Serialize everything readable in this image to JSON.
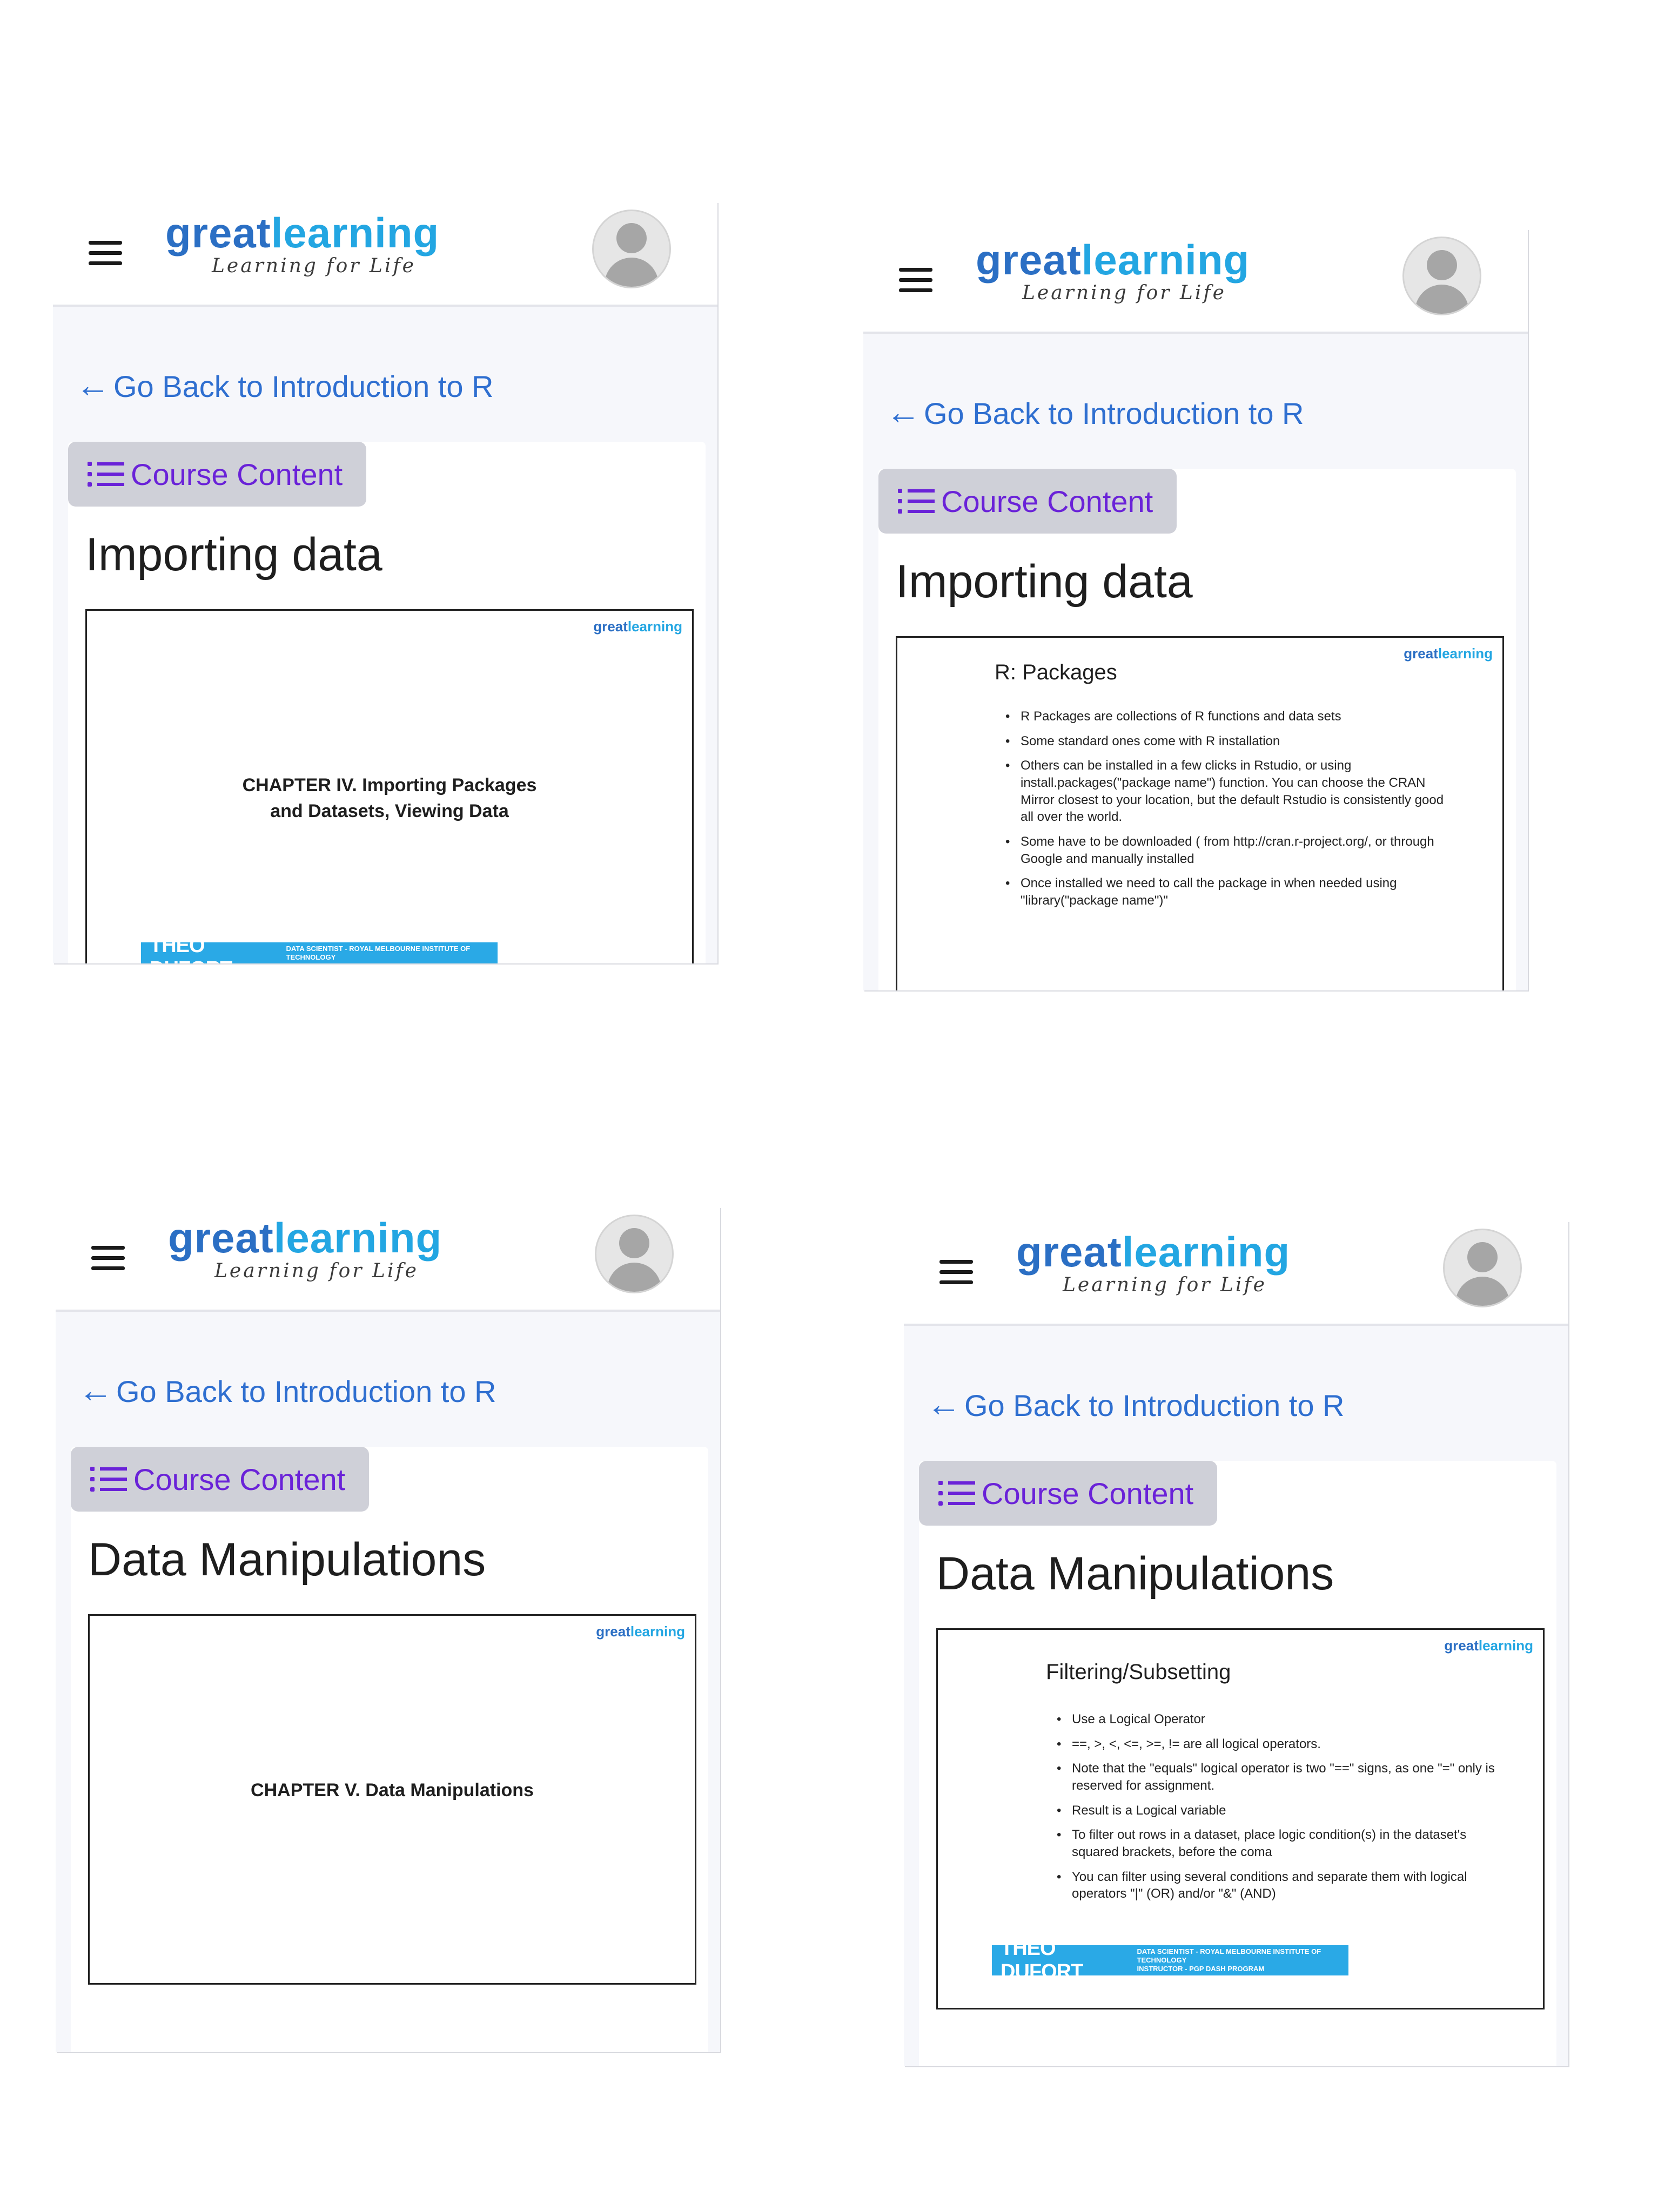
{
  "header": {
    "logo_great": "great",
    "logo_learning": "learning",
    "tagline": "Learning for Life"
  },
  "nav": {
    "back_label": "Go Back to Introduction to R",
    "course_content_label": "Course Content"
  },
  "slide_brand": {
    "logo_great": "great",
    "logo_learning": "learning"
  },
  "instructor": {
    "name": "THEO DUFORT",
    "role_line1": "DATA SCIENTIST - ROYAL MELBOURNE INSTITUTE OF TECHNOLOGY",
    "role_line2": "INSTRUCTOR - PGP DASH PROGRAM"
  },
  "screens": [
    {
      "title": "Importing data",
      "slide": {
        "chapter_line1": "CHAPTER IV.  Importing Packages",
        "chapter_line2": "and Datasets, Viewing Data"
      }
    },
    {
      "title": "Importing data",
      "slide": {
        "heading": "R: Packages",
        "bullets": [
          "R Packages are collections of R functions and data sets",
          "Some standard ones come with R installation",
          "Others can be installed in a few clicks in Rstudio, or using install.packages(\"package name\") function. You can choose the CRAN Mirror closest to your location, but the default Rstudio is consistently good all over the world.",
          "Some have to be downloaded ( from http://cran.r-project.org/, or through Google and manually installed",
          "Once installed we need to call the package in when needed using \"library(\"package name\")\""
        ]
      }
    },
    {
      "title": "Data Manipulations",
      "slide": {
        "chapter_line1": "CHAPTER V.  Data Manipulations"
      }
    },
    {
      "title": "Data Manipulations",
      "slide": {
        "heading": "Filtering/Subsetting",
        "bullets": [
          "Use a Logical Operator",
          "==, >, <, <=, >=, !=    are all logical operators.",
          "Note that the \"equals\" logical operator is two \"==\" signs, as one \"=\" only is reserved for assignment.",
          "Result is a Logical variable",
          "To filter out rows in a dataset, place logic condition(s) in the dataset's squared brackets, before the coma",
          "You can filter using several conditions and separate them with logical operators \"|\" (OR) and/or \"&\" (AND)"
        ]
      }
    }
  ]
}
